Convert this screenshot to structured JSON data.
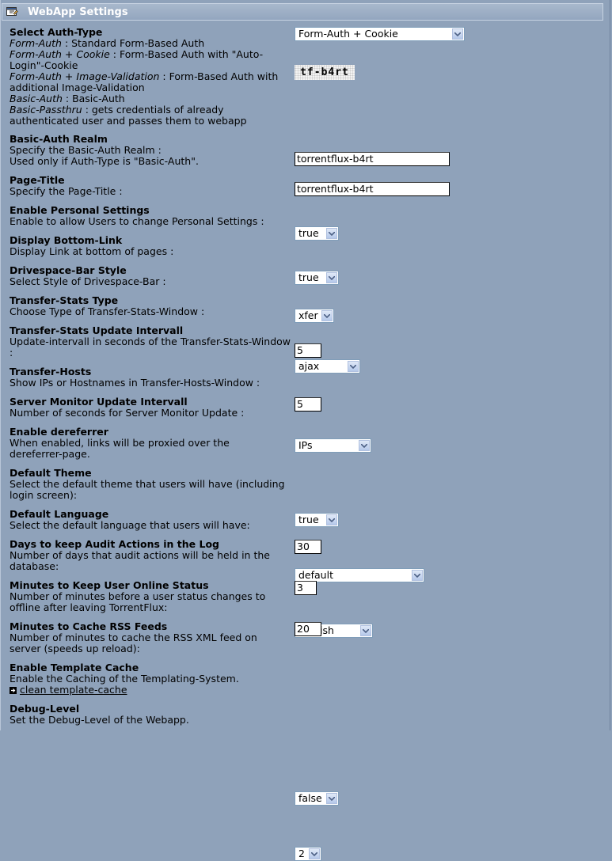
{
  "window": {
    "title": "WebApp Settings"
  },
  "settings": {
    "auth_type": {
      "label": "Select Auth-Type",
      "options": [
        {
          "name": "Form-Auth",
          "text": " : Standard Form-Based Auth"
        },
        {
          "name": "Form-Auth + Cookie",
          "text": " : Form-Based Auth with \"Auto-Login\"-Cookie"
        },
        {
          "name": "Form-Auth + Image-Validation",
          "text": " : Form-Based Auth with additional Image-Validation"
        },
        {
          "name": "Basic-Auth",
          "text": " : Basic-Auth"
        },
        {
          "name": "Basic-Passthru",
          "text": " : gets credentials of already authenticated user and passes them to webapp"
        }
      ],
      "value": "Form-Auth + Cookie",
      "captcha": "tf-b4rt"
    },
    "basic_realm": {
      "label": "Basic-Auth Realm",
      "desc": "Specify the Basic-Auth Realm :\nUsed only if Auth-Type is \"Basic-Auth\".",
      "value": "torrentflux-b4rt"
    },
    "page_title": {
      "label": "Page-Title",
      "desc": "Specify the Page-Title :",
      "value": "torrentflux-b4rt"
    },
    "personal_settings": {
      "label": "Enable Personal Settings",
      "desc": "Enable to allow Users to change Personal Settings :",
      "value": "true"
    },
    "bottom_link": {
      "label": "Display Bottom-Link",
      "desc": "Display Link at bottom of pages :",
      "value": "true"
    },
    "drivespace_style": {
      "label": "Drivespace-Bar Style",
      "desc": "Select Style of Drivespace-Bar :",
      "value": "xfer"
    },
    "transfer_stats_type": {
      "label": "Transfer-Stats Type",
      "desc": "Choose Type of Transfer-Stats-Window :",
      "value": "ajax"
    },
    "transfer_stats_interval": {
      "label": "Transfer-Stats Update Intervall",
      "desc": "Update-intervall in seconds of the Transfer-Stats-Window :",
      "value": "5"
    },
    "transfer_hosts": {
      "label": "Transfer-Hosts",
      "desc": "Show IPs or Hostnames in Transfer-Hosts-Window :",
      "value": "IPs"
    },
    "server_monitor_interval": {
      "label": "Server Monitor Update Intervall",
      "desc": "Number of seconds for Server Monitor Update :",
      "value": "5"
    },
    "dereferrer": {
      "label": "Enable dereferrer",
      "desc": "When enabled, links will be proxied over the dereferrer-page.",
      "value": "true"
    },
    "default_theme": {
      "label": "Default Theme",
      "desc": "Select the default theme that users will have (including login screen):",
      "value": "default"
    },
    "default_language": {
      "label": "Default Language",
      "desc": "Select the default language that users will have:",
      "value": "english"
    },
    "audit_days": {
      "label": "Days to keep Audit Actions in the Log",
      "desc": "Number of days that audit actions will be held in the database:",
      "value": "30"
    },
    "online_minutes": {
      "label": "Minutes to Keep User Online Status",
      "desc": "Number of minutes before a user status changes to offline after leaving TorrentFlux:",
      "value": "3"
    },
    "rss_cache": {
      "label": "Minutes to Cache RSS Feeds",
      "desc": "Number of minutes to cache the RSS XML feed on server (speeds up reload):",
      "value": "20"
    },
    "template_cache": {
      "label": "Enable Template Cache",
      "desc": "Enable the Caching of the Templating-System.",
      "link": "clean template-cache",
      "value": "false"
    },
    "debug_level": {
      "label": "Debug-Level",
      "desc": "Set the Debug-Level of the Webapp.",
      "value": "2"
    }
  },
  "colors": {
    "background": "#8FA2BA",
    "title_text": "#FFFFFF",
    "input_border": "#7F9DB9"
  }
}
